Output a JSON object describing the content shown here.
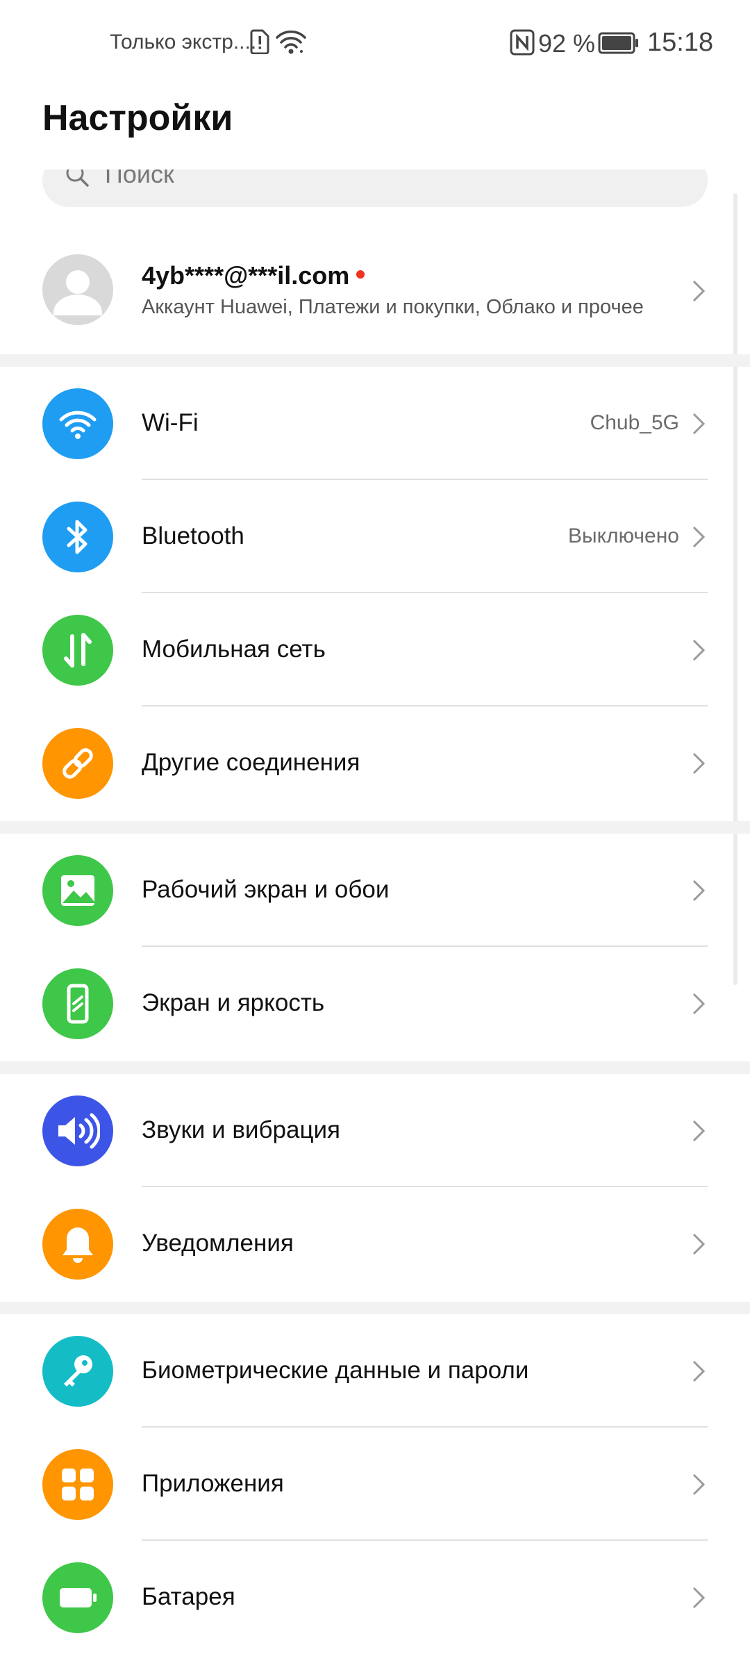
{
  "status_bar": {
    "carrier": "Только экстр....",
    "battery_pct": "92 %",
    "time": "15:18",
    "icons": [
      "sim-alert-icon",
      "wifi-icon",
      "nfc-icon",
      "battery-icon"
    ]
  },
  "header": {
    "title": "Настройки"
  },
  "search": {
    "placeholder": "Поиск",
    "icon": "search-icon"
  },
  "account": {
    "name": "4yb****@***il.com",
    "description": "Аккаунт Huawei, Платежи и покупки, Облако и прочее",
    "icon": "avatar-icon"
  },
  "settings": {
    "wifi": {
      "label": "Wi-Fi",
      "value": "Chub_5G",
      "icon": "wifi-icon",
      "color": "#1e9df2"
    },
    "bluetooth": {
      "label": "Bluetooth",
      "value": "Выключено",
      "icon": "bluetooth-icon",
      "color": "#1e9df2"
    },
    "mobile": {
      "label": "Мобильная сеть",
      "icon": "mobile-data-icon",
      "color": "#3ec748"
    },
    "connections": {
      "label": "Другие соединения",
      "icon": "link-icon",
      "color": "#ff9500"
    },
    "home_screen": {
      "label": "Рабочий экран и обои",
      "icon": "image-icon",
      "color": "#3ec748"
    },
    "display": {
      "label": "Экран и яркость",
      "icon": "display-icon",
      "color": "#3ec748"
    },
    "sounds": {
      "label": "Звуки и вибрация",
      "icon": "speaker-icon",
      "color": "#3d55e6"
    },
    "notifications": {
      "label": "Уведомления",
      "icon": "bell-icon",
      "color": "#ff9500"
    },
    "biometrics": {
      "label": "Биометрические данные и пароли",
      "icon": "key-icon",
      "color": "#14bcc6"
    },
    "apps": {
      "label": "Приложения",
      "icon": "apps-grid-icon",
      "color": "#ff9500"
    },
    "battery": {
      "label": "Батарея",
      "icon": "battery-icon",
      "color": "#3ec748"
    }
  }
}
